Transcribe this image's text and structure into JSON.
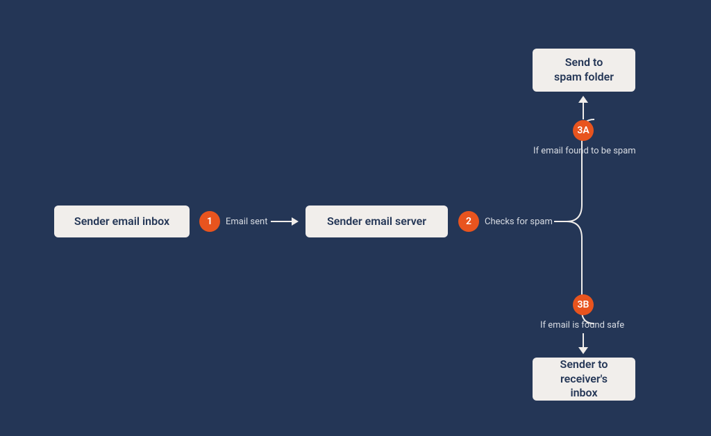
{
  "nodes": {
    "sender_inbox": "Sender email inbox",
    "sender_server": "Sender email server",
    "spam_folder": "Send to\nspam folder",
    "receiver_inbox": "Sender to\nreceiver's inbox"
  },
  "steps": {
    "s1": {
      "num": "1",
      "label": "Email sent"
    },
    "s2": {
      "num": "2",
      "label": "Checks for spam"
    },
    "s3a": {
      "num": "3A",
      "label": "If email found to be spam"
    },
    "s3b": {
      "num": "3B",
      "label": "If email is found safe"
    }
  },
  "colors": {
    "bg": "#243656",
    "box": "#f1eeeb",
    "accent": "#e8541e",
    "text_light": "#d8dce3"
  }
}
